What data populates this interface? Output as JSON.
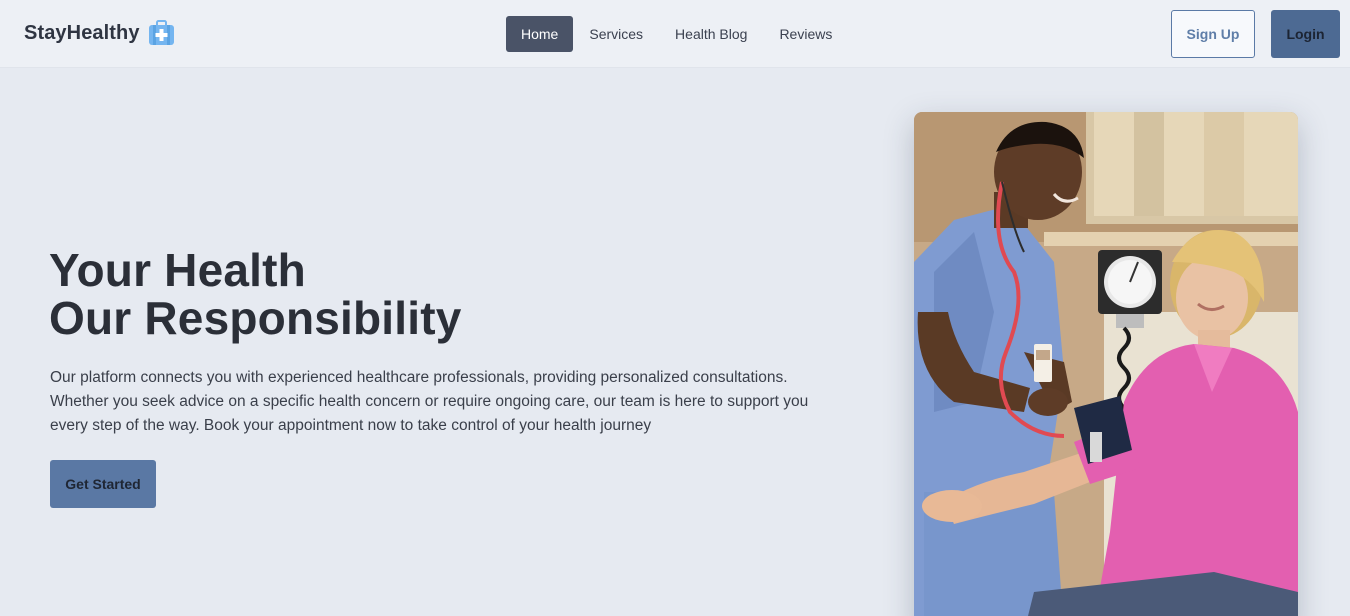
{
  "brand": {
    "name": "StayHealthy",
    "icon": "medical-kit-icon",
    "icon_color": "#74b5f0"
  },
  "nav": {
    "links": [
      {
        "label": "Home",
        "active": true
      },
      {
        "label": "Services",
        "active": false
      },
      {
        "label": "Health Blog",
        "active": false
      },
      {
        "label": "Reviews",
        "active": false
      }
    ],
    "signup_label": "Sign Up",
    "login_label": "Login"
  },
  "hero": {
    "title_line1": "Your Health",
    "title_line2": "Our Responsibility",
    "description": "Our platform connects you with experienced healthcare professionals, providing personalized consultations. Whether you seek advice on a specific health concern or require ongoing care, our team is here to support you every step of the way. Book your appointment now to take control of your health journey",
    "cta_label": "Get Started",
    "image": "nurse-measuring-blood-pressure-photo"
  },
  "colors": {
    "background": "#e6eaf1",
    "nav_active": "#4a5367",
    "primary": "#5a78a4",
    "login": "#4d6a93"
  }
}
